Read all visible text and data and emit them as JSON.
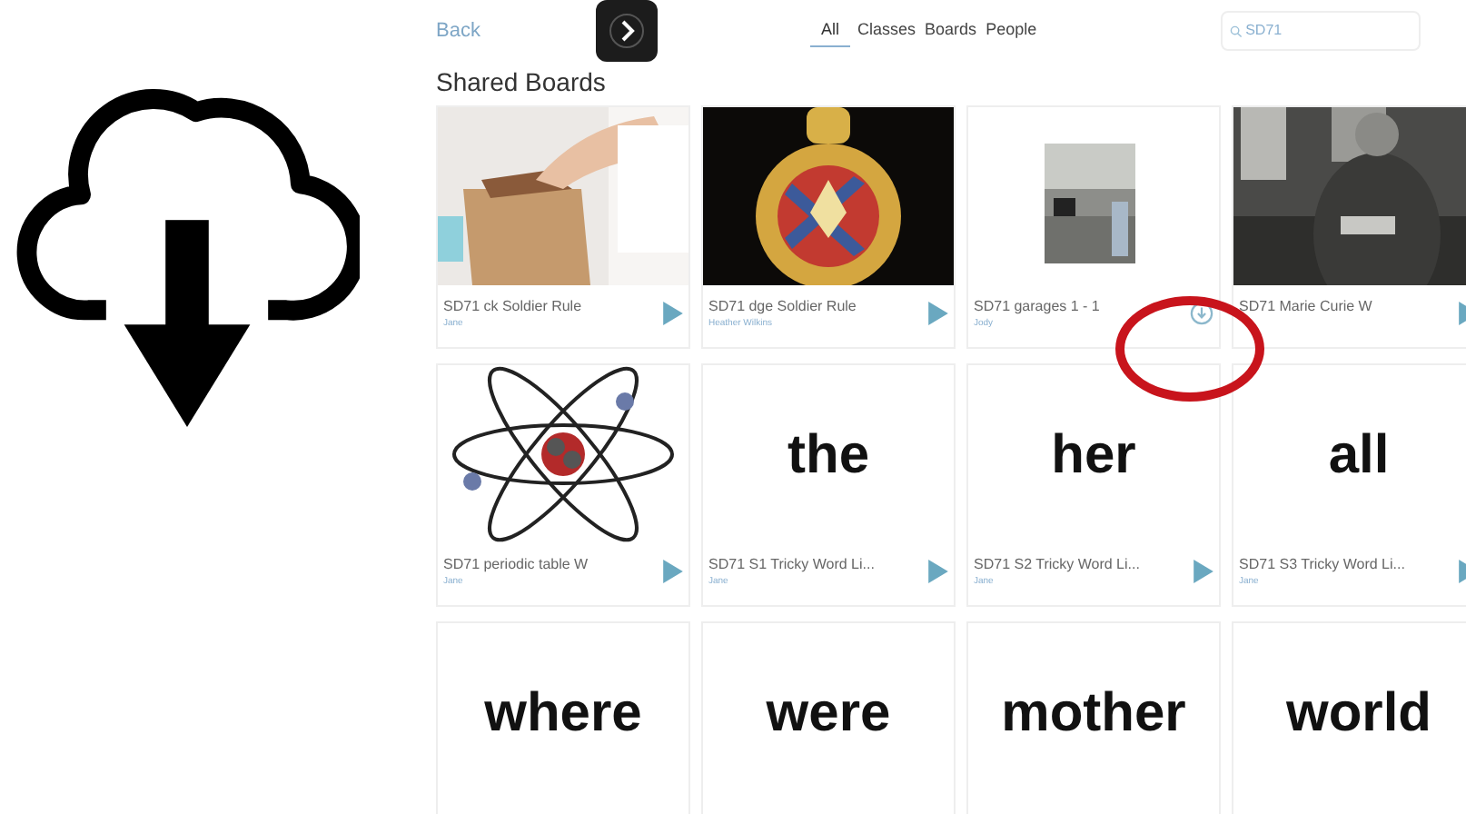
{
  "toolbar": {
    "back": "Back",
    "tabs": [
      {
        "label": "All",
        "selected": true
      },
      {
        "label": "Classes",
        "selected": false
      },
      {
        "label": "Boards",
        "selected": false
      },
      {
        "label": "People",
        "selected": false
      }
    ],
    "search": {
      "value": "SD71"
    }
  },
  "heading": "Shared Boards",
  "cards": [
    {
      "kind": "picture",
      "image": {
        "kind": "box"
      },
      "title": "SD71 ck Soldier Rule",
      "author": "Jane",
      "button": {
        "kind": "play"
      }
    },
    {
      "kind": "picture",
      "image": {
        "kind": "medal"
      },
      "title": "SD71 dge Soldier Rule",
      "author": "Heather Wilkins",
      "button": {
        "kind": "play"
      }
    },
    {
      "kind": "picture",
      "image": {
        "kind": "room"
      },
      "title": "SD71 garages 1 - 1",
      "author": "Jody",
      "button": {
        "kind": "download"
      },
      "highlighted": true
    },
    {
      "kind": "picture",
      "image": {
        "kind": "portrait"
      },
      "title": "SD71 Marie Curie W",
      "button": {
        "kind": "play"
      }
    },
    {
      "kind": "picture",
      "image": {
        "kind": "atom"
      },
      "title": "SD71 periodic table W",
      "author": "Jane",
      "button": {
        "kind": "play"
      }
    },
    {
      "kind": "word",
      "word": "the",
      "title": "SD71 S1 Tricky Word Li...",
      "author": "Jane",
      "button": {
        "kind": "play"
      }
    },
    {
      "kind": "word",
      "word": "her",
      "title": "SD71 S2 Tricky Word Li...",
      "author": "Jane",
      "button": {
        "kind": "play"
      }
    },
    {
      "kind": "word",
      "word": "all",
      "title": "SD71 S3 Tricky Word Li...",
      "author": "Jane",
      "button": {
        "kind": "play"
      }
    },
    {
      "kind": "word",
      "word": "where"
    },
    {
      "kind": "word",
      "word": "were"
    },
    {
      "kind": "word",
      "word": "mother"
    },
    {
      "kind": "word",
      "word": "world"
    }
  ]
}
